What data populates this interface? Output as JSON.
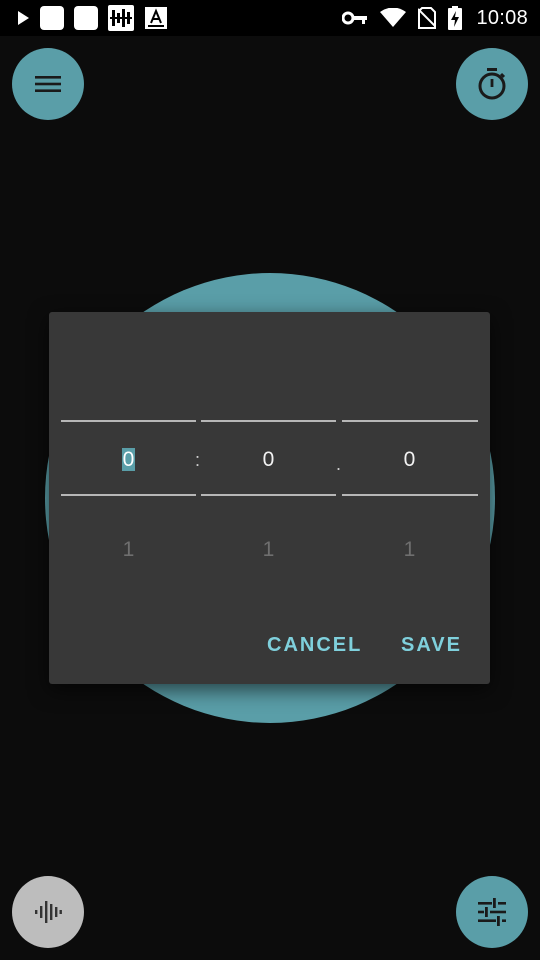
{
  "status_bar": {
    "time": "10:08",
    "left_icons": [
      "play-icon",
      "notification-square-icon",
      "notification-square-icon",
      "equalizer-app-icon",
      "font-app-icon"
    ],
    "right_icons": [
      "vpn-key-icon",
      "wifi-icon",
      "no-sim-icon",
      "battery-charging-icon"
    ]
  },
  "toolbar": {
    "menu_icon": "menu-icon",
    "timer_icon": "stopwatch-icon"
  },
  "bottom": {
    "left_icon": "waveform-icon",
    "right_icon": "tune-sliders-icon"
  },
  "dialog": {
    "minutes": {
      "current": "0",
      "next": "1"
    },
    "seconds": {
      "current": "0",
      "next": "1"
    },
    "tenths": {
      "current": "0",
      "next": "1"
    },
    "separator_colon": ":",
    "separator_dot": ".",
    "cancel_label": "CANCEL",
    "save_label": "SAVE"
  },
  "colors": {
    "accent": "#5a9ea8",
    "button_text": "#7fd0dc",
    "dialog_bg": "#383838",
    "background": "#0c0c0c"
  }
}
